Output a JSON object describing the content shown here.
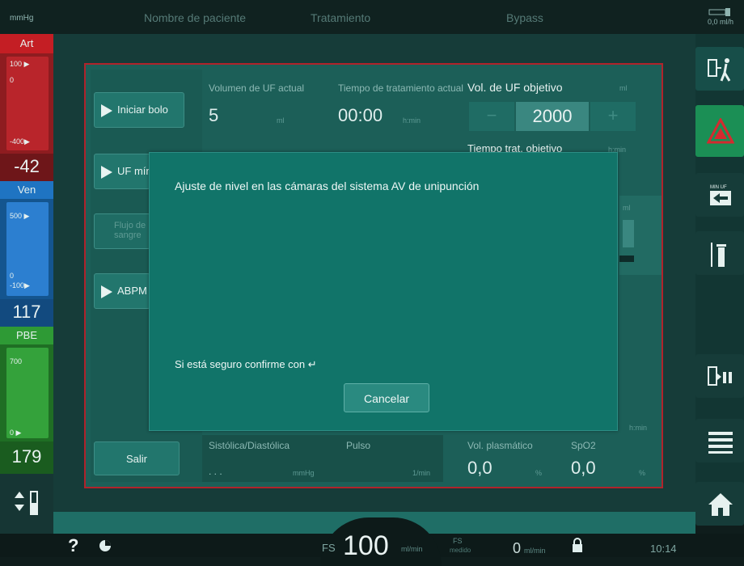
{
  "header": {
    "unit": "mmHg",
    "tabs": [
      "Nombre de paciente",
      "Tratamiento",
      "Bypass"
    ],
    "top_right_value": "0,0",
    "top_right_unit": "ml/h"
  },
  "left": {
    "art": {
      "label": "Art",
      "ticks": [
        "100 ▶",
        "0",
        "-400▶"
      ],
      "value": "-42",
      "color": "#c41e24"
    },
    "ven": {
      "label": "Ven",
      "ticks": [
        "500 ▶",
        "0",
        "-100▶"
      ],
      "value": "117",
      "color": "#1f74c2"
    },
    "pbe": {
      "label": "PBE",
      "ticks": [
        "700",
        "0  ▶"
      ],
      "value": "179",
      "color": "#2e9a35"
    }
  },
  "main": {
    "buttons": {
      "iniciar_bolo": "Iniciar bolo",
      "uf_min": "UF mín",
      "flujo": "Flujo de sangre",
      "abpm": "ABPM",
      "salir": "Salir"
    },
    "uf_volume": {
      "label": "Volumen de UF actual",
      "value": "5",
      "unit": "ml"
    },
    "treat_time": {
      "label": "Tiempo de tratamiento actual",
      "value": "00:00",
      "unit": "h:min"
    },
    "uf_target": {
      "label": "Vol. de UF objetivo",
      "value": "2000",
      "unit": "ml",
      "minus": "−",
      "plus": "+"
    },
    "time_target": {
      "label": "Tiempo trat. objetivo",
      "unit": "h:min"
    },
    "right_partial_unit": "ml",
    "right_partial_unit2": "h:min",
    "bp": {
      "label": "Sistólica/Diastólica",
      "value": ". . .",
      "unit": "mmHg"
    },
    "pulse": {
      "label": "Pulso",
      "unit": "1/min"
    },
    "plasma": {
      "label": "Vol. plasmático",
      "value": "0,0",
      "unit": "%"
    },
    "spo2": {
      "label": "SpO2",
      "value": "0,0",
      "unit": "%"
    }
  },
  "dialog": {
    "title": "Ajuste de nivel en las cámaras del sistema AV de unipunción",
    "confirm": "Si está seguro confirme con ↵",
    "cancel": "Cancelar"
  },
  "footer": {
    "help": "?",
    "fs_label": "FS",
    "fs_value": "100",
    "fs_unit": "ml/min",
    "fs2_label": "FS",
    "fs2_sub": "medido",
    "fs2_value": "0",
    "fs2_unit": "ml/min",
    "time": "10:14"
  },
  "icons": [
    "patient-exit-icon",
    "alarm-triangle-icon",
    "min-uf-icon",
    "syringe-icon",
    "pause-icon",
    "menu-list-icon",
    "home-icon",
    "syringe-level-icon",
    "clock-icon",
    "lock-icon"
  ],
  "colors": {
    "accent": "#1c5f58",
    "dialog": "#117469",
    "alarm_red": "#c41e24",
    "ven_blue": "#1f74c2",
    "pbe_green": "#2e9a35",
    "alarm_button": "#1b8f55"
  }
}
